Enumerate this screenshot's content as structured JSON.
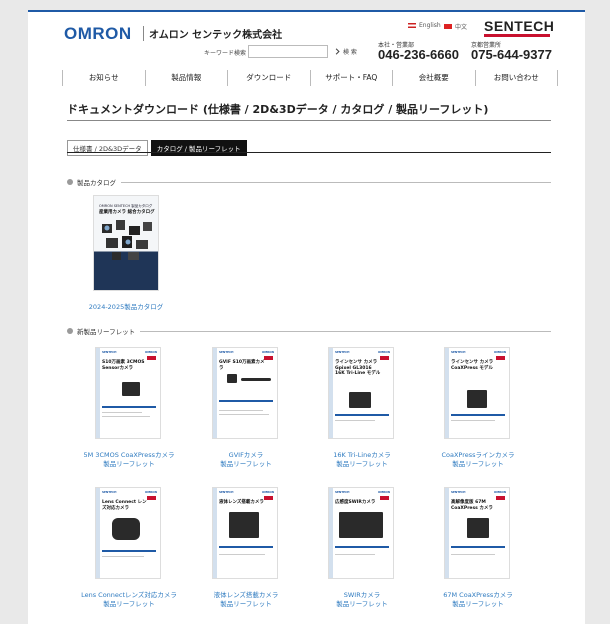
{
  "header": {
    "brand": "OMRON",
    "brand_sub": "オムロン センテック株式会社",
    "lang_en": "English",
    "lang_cn": "中文",
    "sentech_logo": "SENTECH",
    "search_label": "キーワード検索",
    "search_placeholder": "",
    "search_button": "検 索",
    "office1": {
      "label": "本社・営業部",
      "tel": "046-236-6660"
    },
    "office2": {
      "label": "京都営業所",
      "tel": "075-644-9377"
    }
  },
  "nav": [
    "お知らせ",
    "製品情報",
    "ダウンロード",
    "サポート・FAQ",
    "会社概要",
    "お問い合わせ"
  ],
  "page_title": "ドキュメントダウンロード (仕様書 / 2D&3Dデータ / カタログ / 製品リーフレット)",
  "tabs": [
    {
      "label": "仕様書 / 2D&3Dデータ",
      "active": false
    },
    {
      "label": "カタログ / 製品リーフレット",
      "active": true
    }
  ],
  "catalog_section": {
    "title": "製品カタログ",
    "cover_small": "OMRON SENTECH 製品カタログ",
    "cover_title": "産業用カメラ 総合カタログ",
    "caption": "2024-2025製品カタログ"
  },
  "leaflet_section": {
    "title": "新製品リーフレット",
    "items": [
      {
        "head": "S10万画素 3CMOS Sensorカメラ",
        "caption1": "5M 3CMOS CoaXPressカメラ",
        "caption2": "製品リーフレット"
      },
      {
        "head": "GVIF S10万画素カメラ",
        "caption1": "GVIFカメラ",
        "caption2": "製品リーフレット"
      },
      {
        "head": "ラインセンサ カメラ Gpixel GL3016 16K Tri-Line モデル",
        "caption1": "16K Tri-Lineカメラ",
        "caption2": "製品リーフレット"
      },
      {
        "head": "ラインセンサ カメラ CoaXPress モデル",
        "caption1": "CoaXPressラインカメラ",
        "caption2": "製品リーフレット"
      },
      {
        "head": "Lens Connect レンズ対応カメラ",
        "caption1": "Lens Connectレンズ対応カメラ",
        "caption2": "製品リーフレット"
      },
      {
        "head": "液体レンズ搭載カメラ",
        "caption1": "液体レンズ搭載カメラ",
        "caption2": "製品リーフレット"
      },
      {
        "head": "広感度SWIRカメラ",
        "caption1": "SWIRカメラ",
        "caption2": "製品リーフレット"
      },
      {
        "head": "高解像度版 67M CoaXPress カメラ",
        "caption1": "67M CoaXPressカメラ",
        "caption2": "製品リーフレット"
      }
    ]
  },
  "colors": {
    "brand_blue": "#1f5aa6",
    "link": "#2f7bc0",
    "accent_red": "#c8102e"
  }
}
